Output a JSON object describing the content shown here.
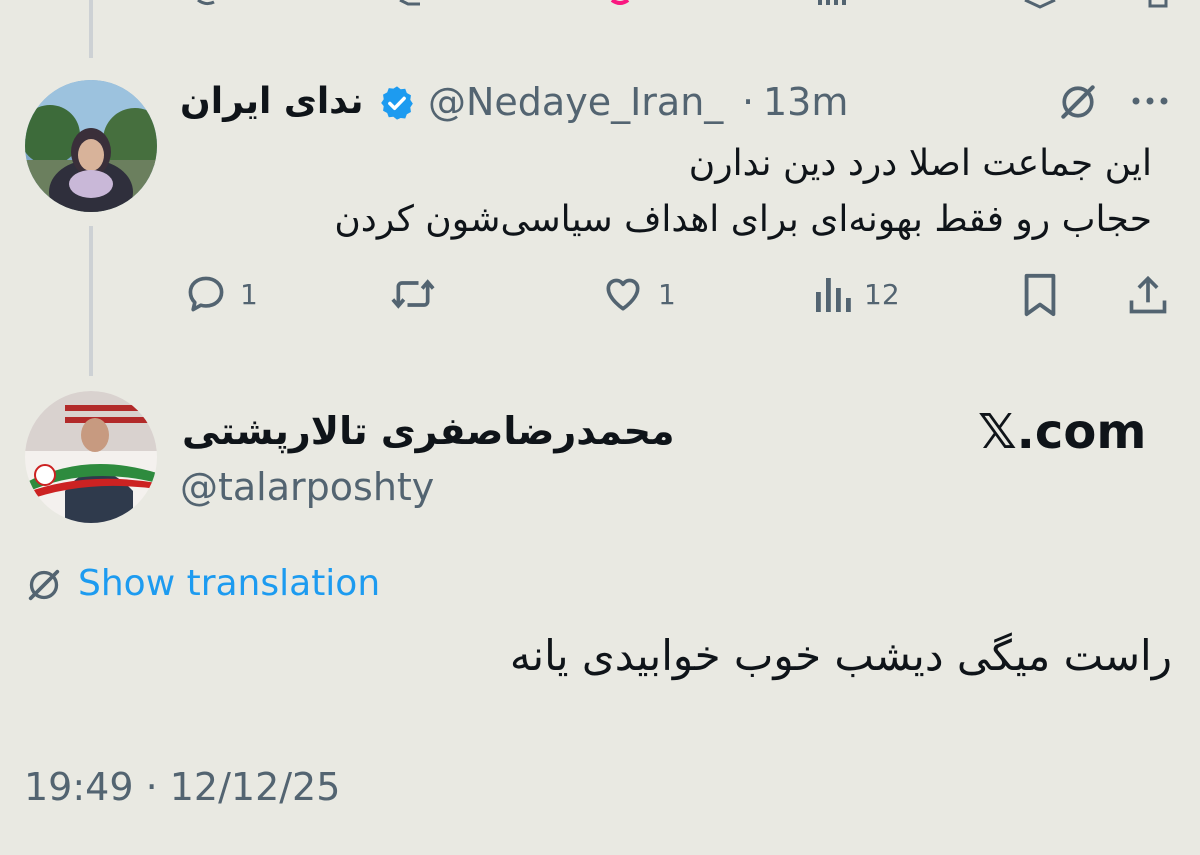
{
  "reply": {
    "display_name": "ندای ایران",
    "handle": "@Nedaye_Iran_",
    "separator": "·",
    "time": "13m",
    "verified_icon": "verified-badge-icon",
    "grok_icon": "grok-icon",
    "more_icon": "more-dots-icon",
    "text_line1": "این جماعت اصلا درد دین ندارن",
    "text_line2": "حجاب رو فقط بهونه‌ای برای اهداف سیاسی‌شون کردن",
    "actions": {
      "replies": "1",
      "retweets": "",
      "likes": "1",
      "views": "12"
    }
  },
  "main": {
    "display_name": "محمدرضاصفری تالارپشتی",
    "handle": "@talarposhty",
    "watermark": "𝕏.com",
    "translate_label": "Show translation",
    "text": "راست میگی دیشب خوب خوابیدی یانه",
    "timestamp": "19:49 · 12/12/25"
  },
  "colors": {
    "background": "#e9e9e2",
    "link": "#1d9bf0",
    "verified": "#1d9bf0",
    "muted": "#536471",
    "like_pink": "#f91880"
  }
}
